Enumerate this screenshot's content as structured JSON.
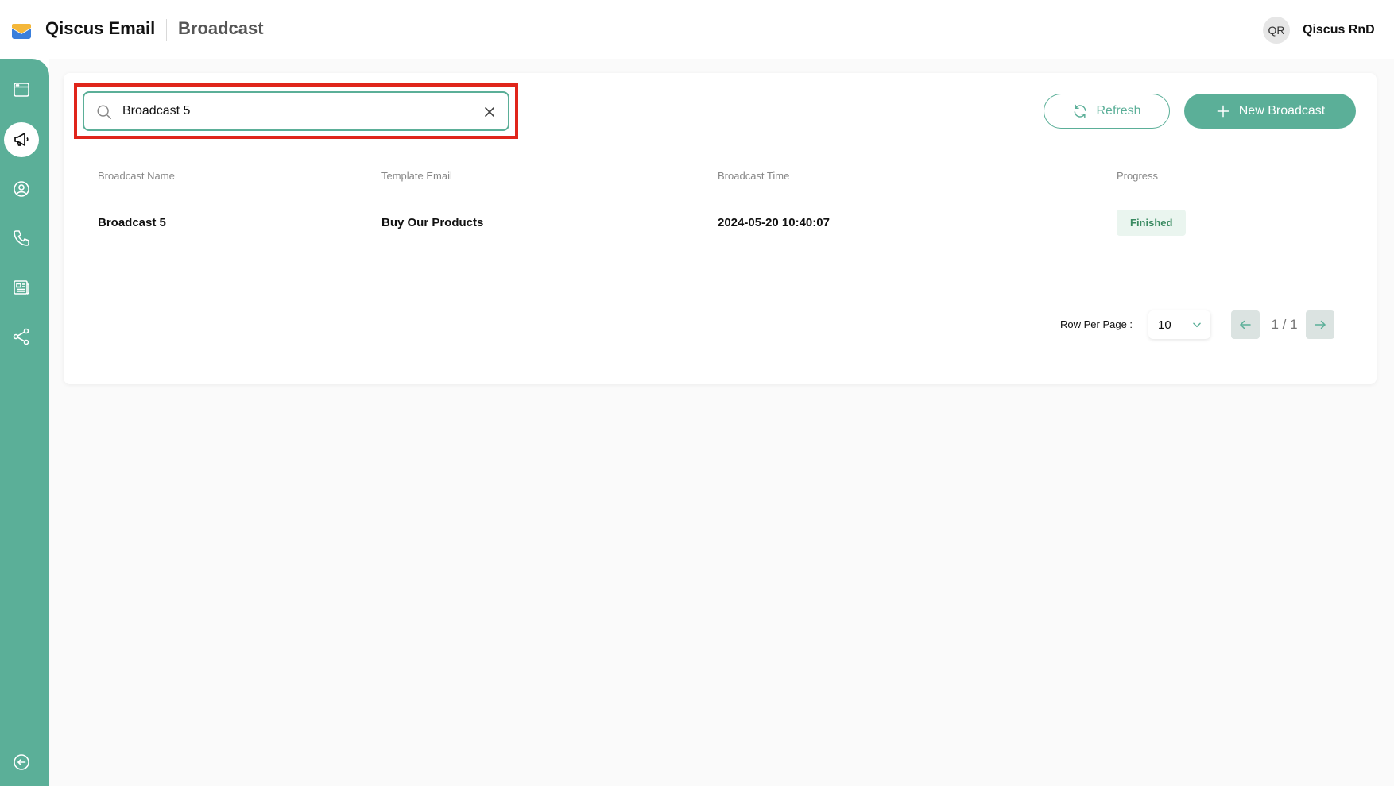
{
  "app": {
    "name": "Qiscus Email",
    "page_title": "Broadcast"
  },
  "user": {
    "initials": "QR",
    "name": "Qiscus RnD"
  },
  "sidebar": {
    "items": [
      {
        "icon": "window-icon",
        "active": false
      },
      {
        "icon": "megaphone-icon",
        "active": true
      },
      {
        "icon": "user-circle-icon",
        "active": false
      },
      {
        "icon": "phone-icon",
        "active": false
      },
      {
        "icon": "newspaper-icon",
        "active": false
      },
      {
        "icon": "share-nodes-icon",
        "active": false
      }
    ],
    "bottom_icon": "collapse-arrow-icon"
  },
  "search": {
    "value": "Broadcast 5",
    "placeholder": ""
  },
  "toolbar": {
    "refresh_label": "Refresh",
    "new_label": "New Broadcast"
  },
  "table": {
    "headers": [
      "Broadcast Name",
      "Template Email",
      "Broadcast Time",
      "Progress"
    ],
    "rows": [
      {
        "name": "Broadcast 5",
        "template": "Buy Our Products",
        "time": "2024-05-20 10:40:07",
        "progress": "Finished"
      }
    ]
  },
  "pagination": {
    "rows_per_page_label": "Row Per Page :",
    "rows_per_page": "10",
    "page_indicator": "1 / 1"
  },
  "colors": {
    "primary": "#5baf98",
    "highlight": "#e0251b",
    "status_bg": "#eaf5ef",
    "status_text": "#3a8a61"
  }
}
